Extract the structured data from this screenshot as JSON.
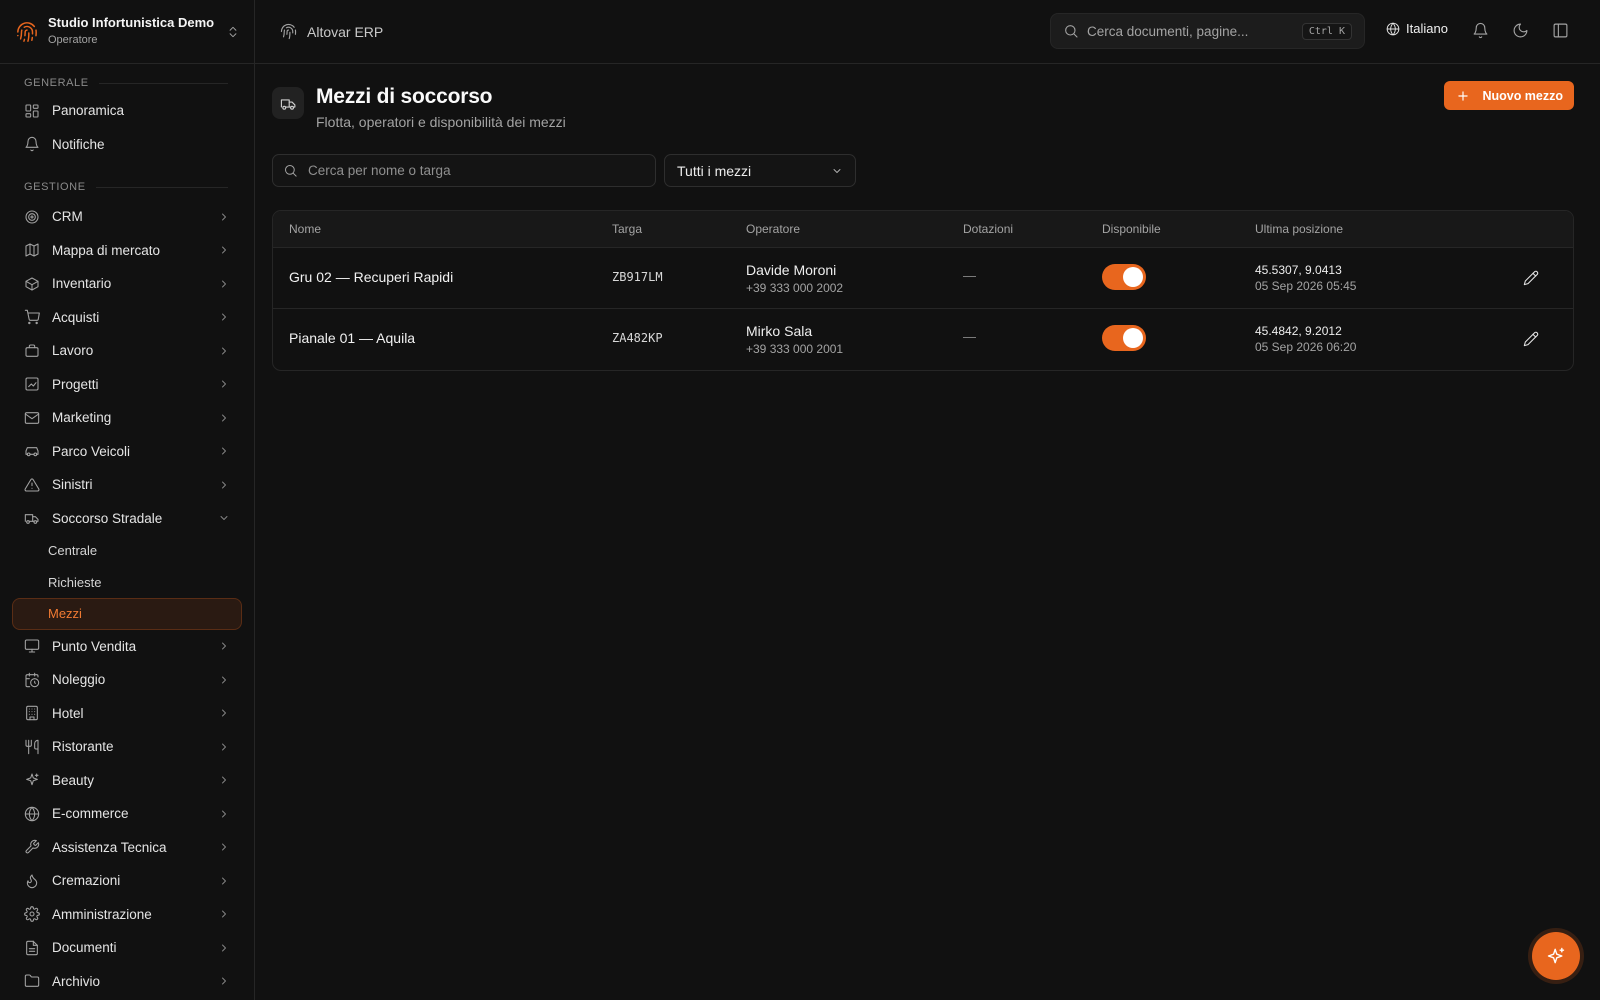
{
  "brand": {
    "name": "Studio Infortunistica Demo",
    "role": "Operatore"
  },
  "colors": {
    "accent": "#e8661e",
    "background": "#111111",
    "border": "#262626"
  },
  "sidebar": {
    "sections": [
      {
        "title": "Generale"
      },
      {
        "title": "Gestione"
      }
    ],
    "general_items": [
      {
        "label": "Panoramica",
        "icon": "dashboard-icon"
      },
      {
        "label": "Notifiche",
        "icon": "bell-icon"
      }
    ],
    "items": [
      {
        "label": "CRM",
        "icon": "target-icon"
      },
      {
        "label": "Mappa di mercato",
        "icon": "map-icon"
      },
      {
        "label": "Inventario",
        "icon": "package-icon"
      },
      {
        "label": "Acquisti",
        "icon": "cart-icon"
      },
      {
        "label": "Lavoro",
        "icon": "briefcase-icon"
      },
      {
        "label": "Progetti",
        "icon": "chart-icon"
      },
      {
        "label": "Marketing",
        "icon": "mail-icon"
      },
      {
        "label": "Parco Veicoli",
        "icon": "car-icon"
      },
      {
        "label": "Sinistri",
        "icon": "alert-triangle-icon"
      },
      {
        "label": "Soccorso Stradale",
        "icon": "tow-truck-icon",
        "expanded": true
      },
      {
        "label": "Punto Vendita",
        "icon": "monitor-icon"
      },
      {
        "label": "Noleggio",
        "icon": "calendar-clock-icon"
      },
      {
        "label": "Hotel",
        "icon": "building-icon"
      },
      {
        "label": "Ristorante",
        "icon": "utensils-icon"
      },
      {
        "label": "Beauty",
        "icon": "sparkles-icon"
      },
      {
        "label": "E-commerce",
        "icon": "globe-icon"
      },
      {
        "label": "Assistenza Tecnica",
        "icon": "wrench-icon"
      },
      {
        "label": "Cremazioni",
        "icon": "flame-icon"
      },
      {
        "label": "Amministrazione",
        "icon": "settings-icon"
      },
      {
        "label": "Documenti",
        "icon": "file-icon"
      },
      {
        "label": "Archivio",
        "icon": "folder-icon"
      }
    ],
    "sub_items": [
      {
        "label": "Centrale"
      },
      {
        "label": "Richieste"
      },
      {
        "label": "Mezzi",
        "active": true
      }
    ]
  },
  "topbar": {
    "app_name": "Altovar ERP",
    "search_placeholder": "Cerca documenti, pagine...",
    "search_shortcut": "Ctrl K",
    "language": "Italiano"
  },
  "page": {
    "title": "Mezzi di soccorso",
    "subtitle": "Flotta, operatori e disponibilità dei mezzi",
    "new_button": "Nuovo mezzo",
    "search_placeholder": "Cerca per nome o targa",
    "filter_value": "Tutti i mezzi"
  },
  "table": {
    "columns": [
      "Nome",
      "Targa",
      "Operatore",
      "Dotazioni",
      "Disponibile",
      "Ultima posizione"
    ],
    "rows": [
      {
        "name": "Gru 02 — Recuperi Rapidi",
        "plate": "ZB917LM",
        "operator_name": "Davide Moroni",
        "operator_phone": "+39 333 000 2002",
        "equipment": "—",
        "available": true,
        "coords": "45.5307, 9.0413",
        "date": "05 Sep 2026 05:45"
      },
      {
        "name": "Pianale 01 — Aquila",
        "plate": "ZA482KP",
        "operator_name": "Mirko Sala",
        "operator_phone": "+39 333 000 2001",
        "equipment": "—",
        "available": true,
        "coords": "45.4842, 9.2012",
        "date": "05 Sep 2026 06:20"
      }
    ]
  }
}
